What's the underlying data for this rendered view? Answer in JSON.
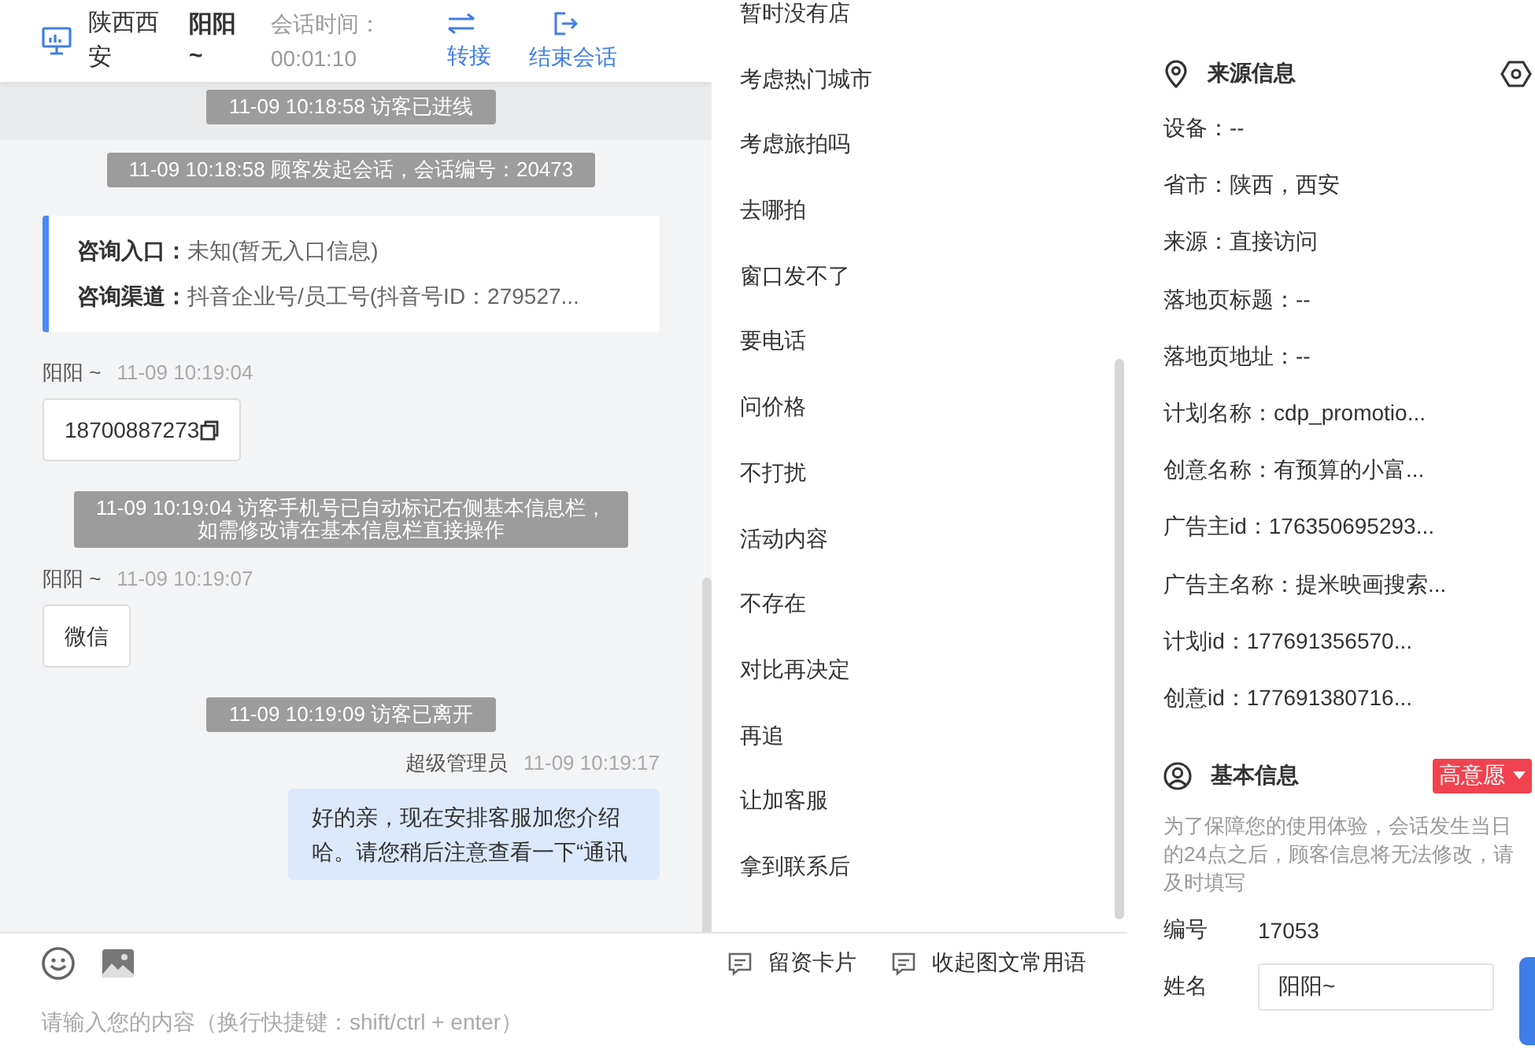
{
  "header": {
    "location": "陕西西安",
    "visitor": "阳阳~",
    "timer_label": "会话时间：",
    "timer": "00:01:10",
    "actions": [
      {
        "kind": "transfer",
        "label": "转接"
      },
      {
        "kind": "end",
        "label": "结束会话"
      }
    ]
  },
  "messages": [
    {
      "kind": "system",
      "band": true,
      "lines": [
        "11-09 10:18:58 访客已进线"
      ]
    },
    {
      "kind": "system",
      "band": false,
      "lines": [
        "11-09 10:18:58 顾客发起会话，会话编号：20473"
      ]
    },
    {
      "kind": "info",
      "lines": [
        {
          "label": "咨询入口：",
          "value": "未知(暂无入口信息)"
        },
        {
          "label": "咨询渠道：",
          "value": "抖音企业号/员工号(抖音号ID：279527..."
        }
      ]
    },
    {
      "kind": "visitor",
      "sender": "阳阳 ~",
      "time": "11-09 10:19:04",
      "text": "18700887273",
      "copyable": true
    },
    {
      "kind": "system",
      "band": false,
      "lines": [
        "11-09 10:19:04 访客手机号已自动标记右侧基本信息栏，",
        "如需修改请在基本信息栏直接操作"
      ]
    },
    {
      "kind": "visitor",
      "sender": "阳阳 ~",
      "time": "11-09 10:19:07",
      "text": "微信",
      "copyable": false
    },
    {
      "kind": "system",
      "band": false,
      "lines": [
        "11-09 10:19:09 访客已离开"
      ]
    },
    {
      "kind": "agent",
      "sender": "超级管理员",
      "time": "11-09 10:19:17",
      "text": "好的亲，现在安排客服加您介绍哈。请您稍后注意查看一下“通讯"
    }
  ],
  "phrases": [
    "暂时没有店",
    "考虑热门城市",
    "考虑旅拍吗",
    "去哪拍",
    "窗口发不了",
    "要电话",
    "问价格",
    "不打扰",
    "活动内容",
    "不存在",
    "对比再决定",
    "再追",
    "让加客服",
    "拿到联系后"
  ],
  "composer": {
    "tools": [
      {
        "kind": "emoji"
      },
      {
        "kind": "image"
      }
    ],
    "buttons": [
      "留资卡片",
      "收起图文常用语"
    ],
    "placeholder": "请输入您的内容（换行快捷键：shift/ctrl + enter）"
  },
  "source_info": {
    "title": "来源信息",
    "fields": [
      "设备：--",
      "省市：陕西，西安",
      "来源：直接访问",
      "落地页标题：--",
      "落地页地址：--",
      "计划名称：cdp_promotio...",
      "创意名称：有预算的小富...",
      "广告主id：176350695293...",
      "广告主名称：提米映画搜索...",
      "计划id：177691356570...",
      "创意id：177691380716..."
    ]
  },
  "basic_info": {
    "title": "基本信息",
    "intent_tag": "高意愿",
    "notice": "为了保障您的使用体验，会话发生当日的24点之后，顾客信息将无法修改，请及时填写",
    "fields": [
      {
        "kind": "text",
        "label": "编号",
        "value": "17053"
      },
      {
        "kind": "input",
        "label": "姓名",
        "value": "阳阳~"
      }
    ]
  }
}
